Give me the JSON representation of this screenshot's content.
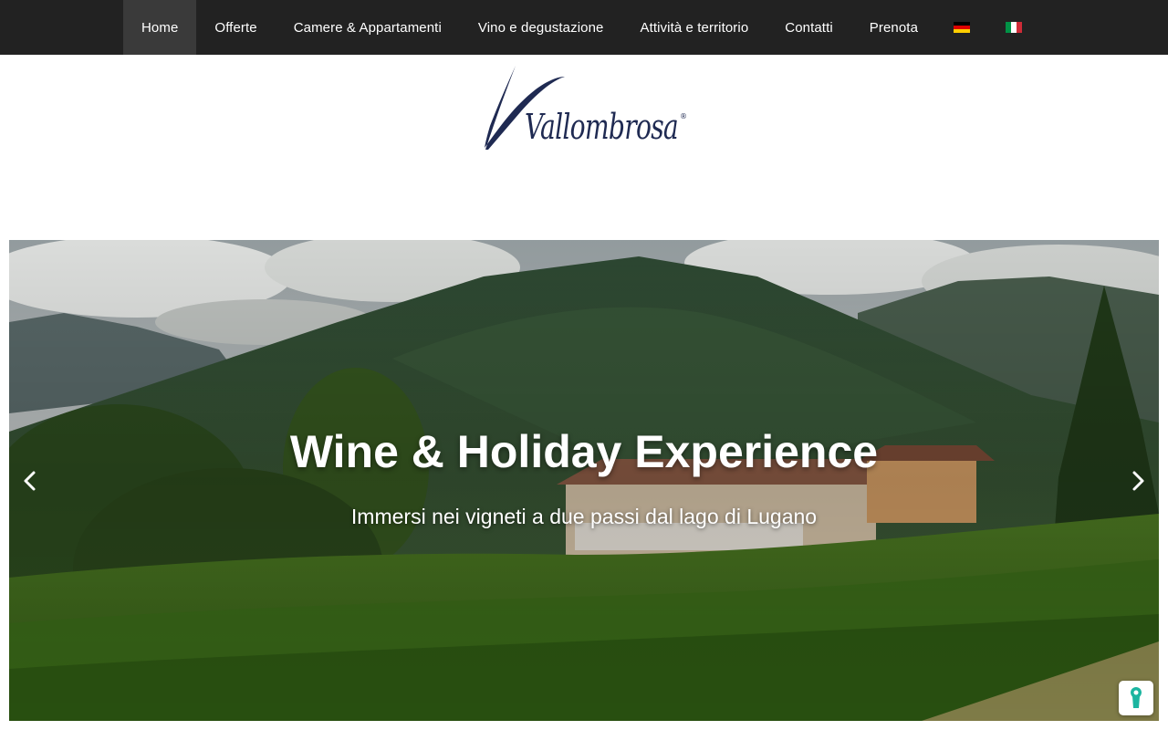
{
  "nav": {
    "items": [
      {
        "label": "Home",
        "active": true
      },
      {
        "label": "Offerte"
      },
      {
        "label": "Camere & Appartamenti"
      },
      {
        "label": "Vino e degustazione"
      },
      {
        "label": "Attività e territorio"
      },
      {
        "label": "Contatti"
      },
      {
        "label": "Prenota"
      }
    ],
    "languages": [
      {
        "code": "de",
        "icon": "germany-flag-icon"
      },
      {
        "code": "it",
        "icon": "italy-flag-icon"
      }
    ]
  },
  "logo": {
    "text": "Vallombrosa",
    "mark": "®",
    "color": "#1f2a52"
  },
  "hero": {
    "title": "Wine & Holiday Experience",
    "subtitle": "Immersi nei vigneti a due passi dal lago di Lugano"
  },
  "colors": {
    "topbar": "#222222",
    "active_tab": "#3a3a3a",
    "cookie_icon": "#1bb5a0"
  }
}
